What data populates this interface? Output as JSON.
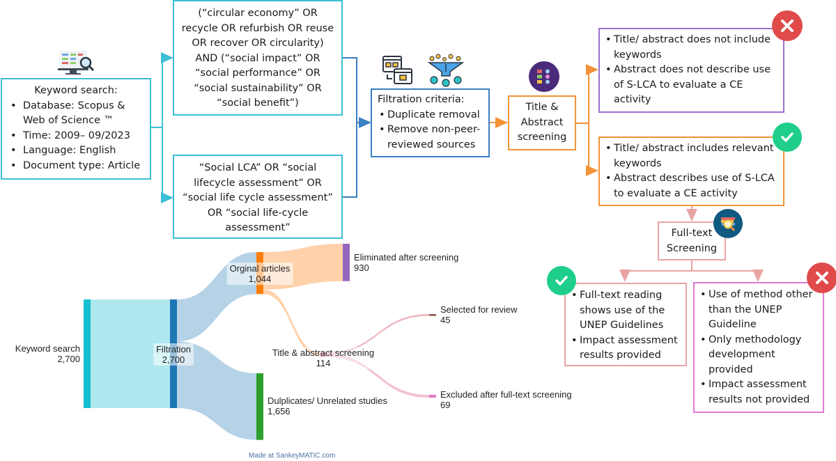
{
  "flowchart": {
    "keyword_box": {
      "title": "Keyword search:",
      "items": [
        "Database: Scopus & Web of Science ™",
        "Time: 2009– 09/2023",
        "Language: English",
        "Document type: Article"
      ]
    },
    "query_box_1": {
      "lines": [
        "(“circular economy” OR",
        "recycle OR refurbish OR reuse",
        "OR recover OR circularity)",
        "AND (“social impact” OR",
        "“social performance” OR",
        "“social sustainability” OR",
        "“social benefit”)"
      ]
    },
    "query_box_2": {
      "lines": [
        "“Social LCA” OR “social",
        "lifecycle assessment” OR",
        "“social life cycle assessment”",
        "OR “social life-cycle",
        "assessment”"
      ]
    },
    "filtration_box": {
      "title": "Filtration criteria:",
      "items": [
        "Duplicate removal",
        "Remove non-peer-reviewed sources"
      ]
    },
    "title_abstract_box": {
      "lines": [
        "Title &",
        "Abstract",
        "screening"
      ]
    },
    "reject_box_1": {
      "items": [
        "Title/ abstract does not include keywords",
        "Abstract does not describe use of S-LCA to evaluate a CE activity"
      ]
    },
    "accept_box_1": {
      "items": [
        "Title/ abstract includes relevant keywords",
        "Abstract describes use of S-LCA to evaluate a CE activity"
      ]
    },
    "fulltext_box": {
      "lines": [
        "Full-text",
        "Screening"
      ]
    },
    "accept_box_2": {
      "items": [
        "Full-text reading shows use of the UNEP Guidelines",
        "Impact assessment results provided"
      ]
    },
    "reject_box_2": {
      "items": [
        "Use of method other than the UNEP Guideline",
        "Only methodology development provided",
        "Impact assessment results not provided"
      ]
    },
    "icons": {
      "keyword": "monitor-search-icon",
      "files": "folder-copy-icon",
      "funnel": "funnel-filter-icon",
      "checklist": "checklist-icon",
      "fulltext": "books-magnifier-icon",
      "reject": "x-circle-icon",
      "accept": "check-circle-icon"
    },
    "colors": {
      "cyan": "#3bbfd6",
      "blue": "#3a7fc0",
      "orange": "#f39237",
      "purple": "#9b6fd1",
      "pink": "#e8a3a3",
      "magenta": "#e07ad2",
      "red_badge": "#e04a4a",
      "green_badge": "#1fce8b"
    }
  },
  "chart_data": {
    "type": "sankey",
    "credit": "Made at SankeyMATIC.com",
    "nodes": [
      {
        "id": "keyword",
        "name": "Keyword search",
        "value": 2700,
        "value_label": "2,700",
        "color": "#17becf"
      },
      {
        "id": "filtration",
        "name": "Filtration",
        "value": 2700,
        "value_label": "2,700",
        "color": "#1f77b4"
      },
      {
        "id": "original",
        "name": "Orginal articles",
        "value": 1044,
        "value_label": "1,044",
        "color": "#ff7f0e"
      },
      {
        "id": "duplicates",
        "name": "Dulplicates/ Unrelated studies",
        "value": 1656,
        "value_label": "1,656",
        "color": "#2ca02c"
      },
      {
        "id": "eliminated",
        "name": "Eliminated after screening",
        "value": 930,
        "value_label": "930",
        "color": "#9467bd"
      },
      {
        "id": "title_abs",
        "name": "Title & abstract screening",
        "value": 114,
        "value_label": "114",
        "color": "#e377a0"
      },
      {
        "id": "selected",
        "name": "Selected for review",
        "value": 45,
        "value_label": "45",
        "color": "#8c564b"
      },
      {
        "id": "excluded",
        "name": "Excluded after full-text screening",
        "value": 69,
        "value_label": "69",
        "color": "#e377c2"
      }
    ],
    "links": [
      {
        "source": "keyword",
        "target": "filtration",
        "value": 2700
      },
      {
        "source": "filtration",
        "target": "original",
        "value": 1044
      },
      {
        "source": "filtration",
        "target": "duplicates",
        "value": 1656
      },
      {
        "source": "original",
        "target": "eliminated",
        "value": 930
      },
      {
        "source": "original",
        "target": "title_abs",
        "value": 114
      },
      {
        "source": "title_abs",
        "target": "selected",
        "value": 45
      },
      {
        "source": "title_abs",
        "target": "excluded",
        "value": 69
      }
    ]
  }
}
